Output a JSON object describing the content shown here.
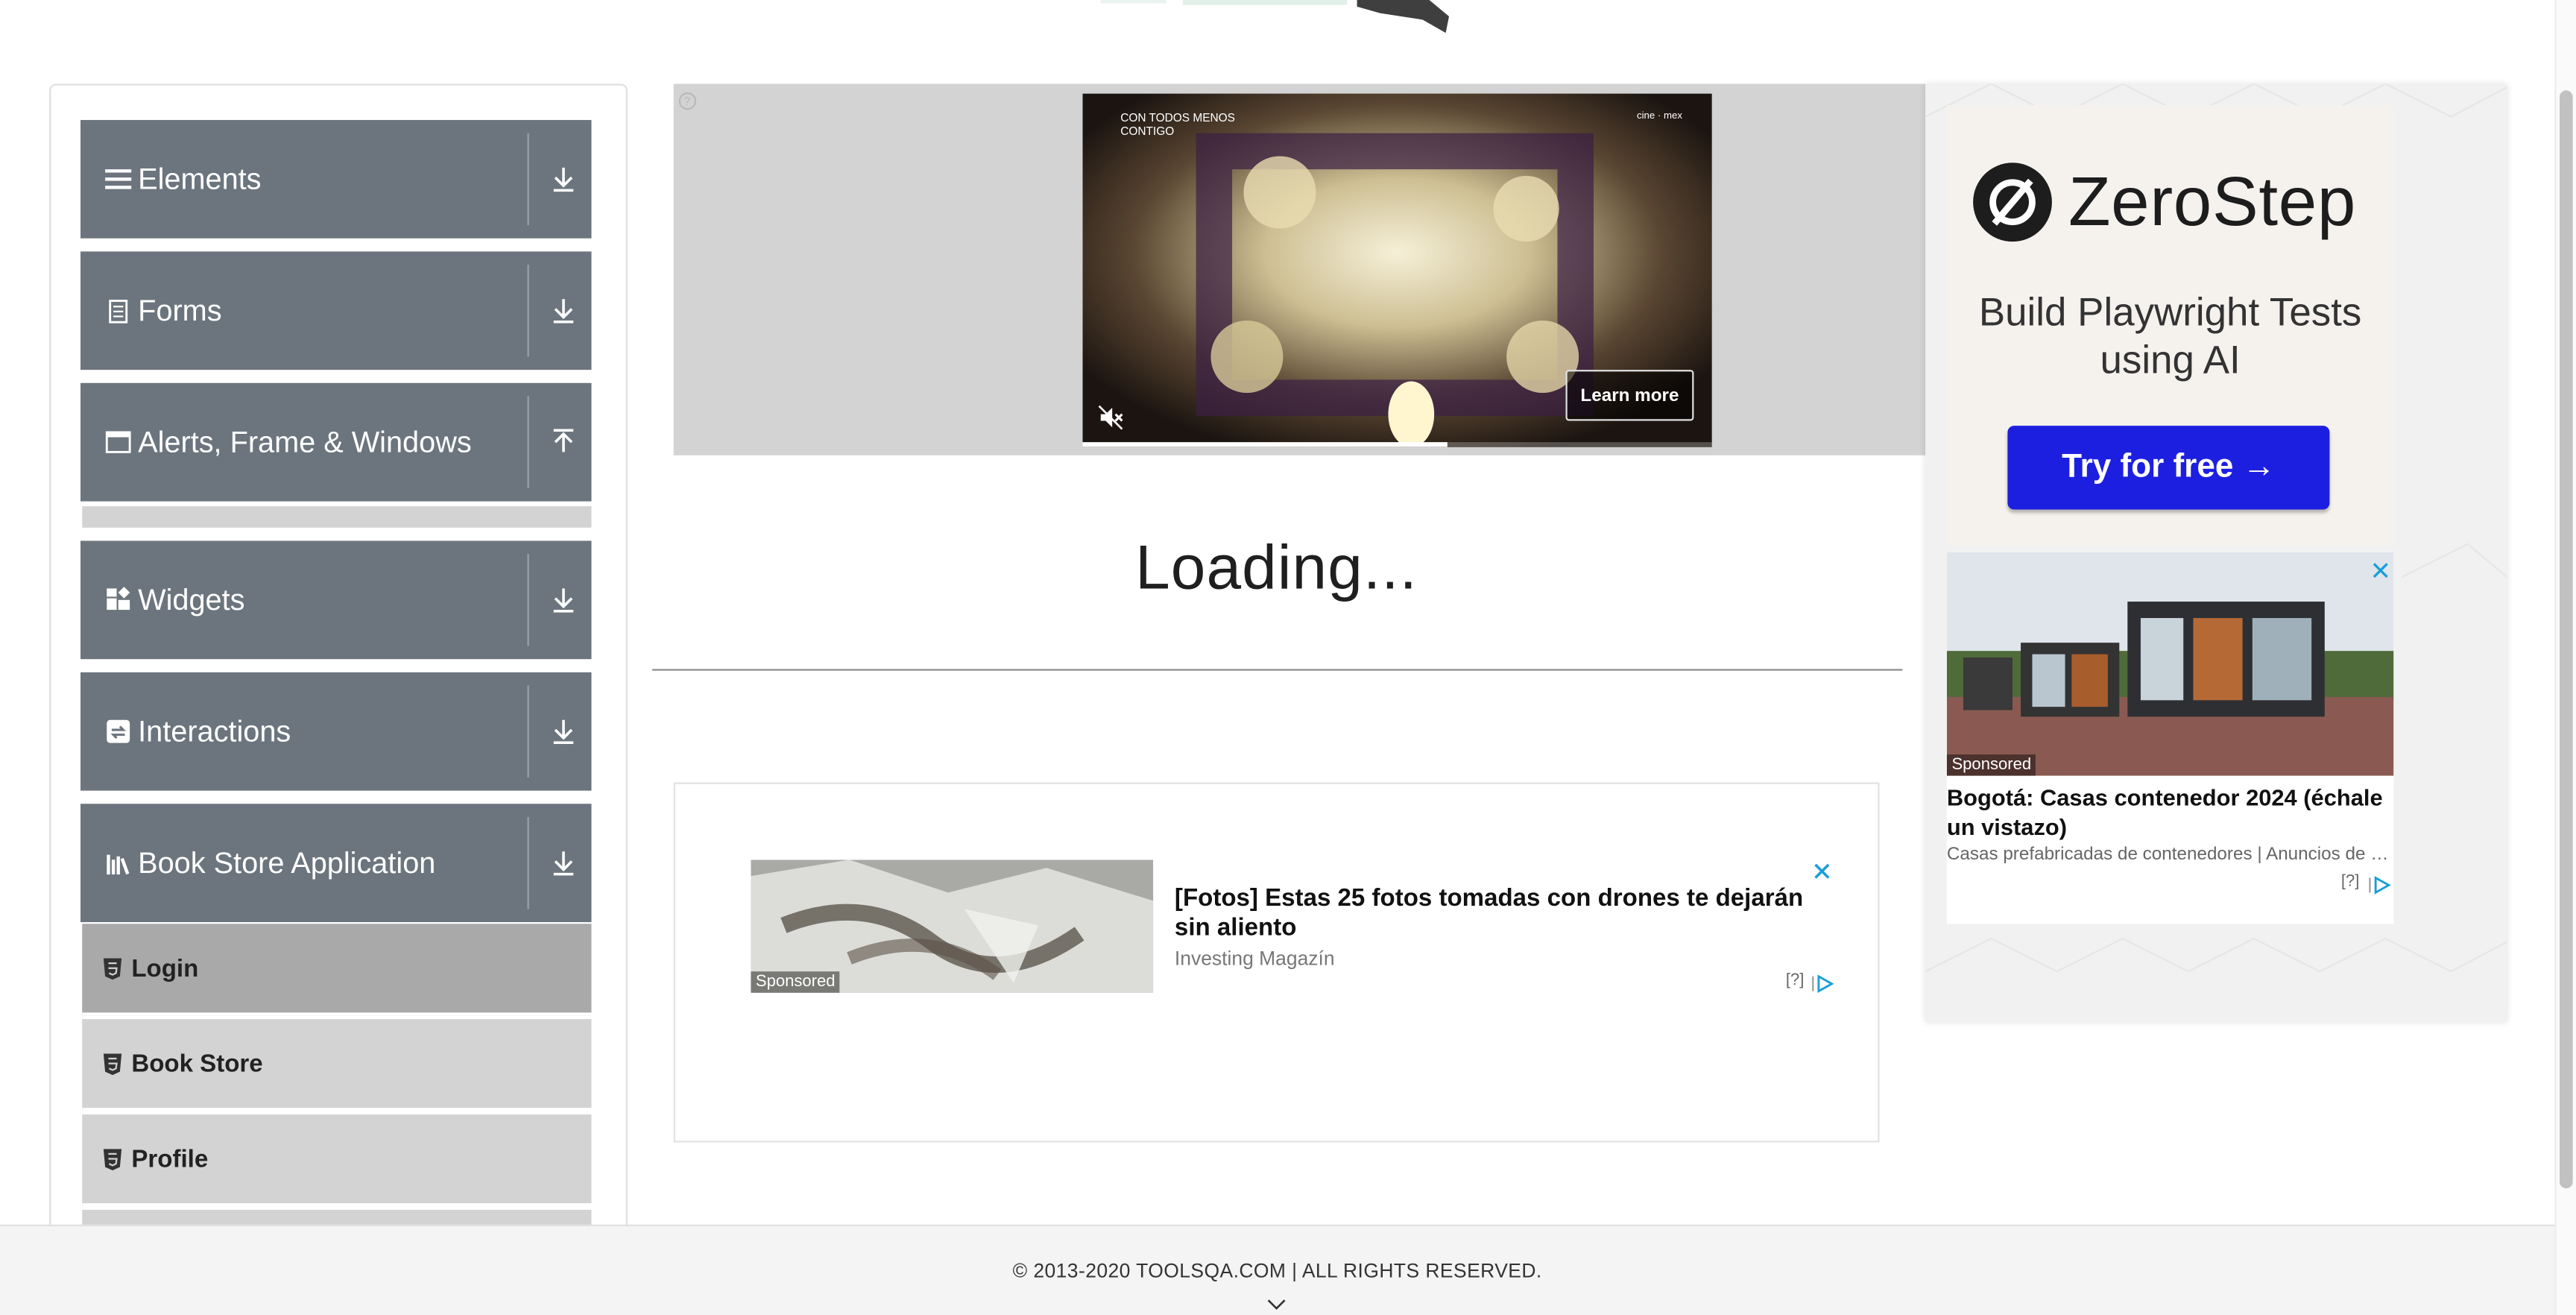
{
  "sidebar": {
    "groups": [
      {
        "label": "Elements",
        "icon": "hamburger-icon",
        "toggle": "download-arrow-icon"
      },
      {
        "label": "Forms",
        "icon": "form-icon",
        "toggle": "download-arrow-icon"
      },
      {
        "label": "Alerts, Frame & Windows",
        "icon": "window-icon",
        "toggle": "upload-arrow-icon"
      },
      {
        "label": "Widgets",
        "icon": "widgets-icon",
        "toggle": "download-arrow-icon"
      },
      {
        "label": "Interactions",
        "icon": "interactions-icon",
        "toggle": "download-arrow-icon"
      },
      {
        "label": "Book Store Application",
        "icon": "library-icon",
        "toggle": "download-arrow-icon"
      }
    ],
    "book_store_items": [
      {
        "label": "Login",
        "active": true
      },
      {
        "label": "Book Store",
        "active": false
      },
      {
        "label": "Profile",
        "active": false
      }
    ]
  },
  "video_ad": {
    "overlay_text": "CON TODOS MENOS CONTIGO",
    "brand": "cine · mex",
    "learn_more": "Learn more",
    "progress": 0.58
  },
  "main": {
    "loading_text": "Loading..."
  },
  "article_ad": {
    "sponsored": "Sponsored",
    "title": "[Fotos] Estas 25 fotos tomadas con drones te dejarán sin aliento",
    "source": "Investing Magazín",
    "adchoice": "[?]"
  },
  "right_ad": {
    "brand": "ZeroStep",
    "tagline": "Build Playwright Tests using AI",
    "cta": "Try for free →",
    "house_sponsored": "Sponsored",
    "house_title": "Bogotá: Casas contenedor 2024 (échale un vistazo)",
    "house_desc": "Casas prefabricadas de contenedores | Anuncios de b...",
    "adchoice": "[?]"
  },
  "footer": {
    "text": "© 2013-2020 TOOLSQA.COM | ALL RIGHTS RESERVED."
  },
  "colors": {
    "group_bg": "#6c757d",
    "sub_item_bg": "#d3d3d3",
    "sub_item_active_bg": "#a9a9a9",
    "cta_blue": "#1d1fe0",
    "adchoice_blue": "#1a9ed9"
  }
}
